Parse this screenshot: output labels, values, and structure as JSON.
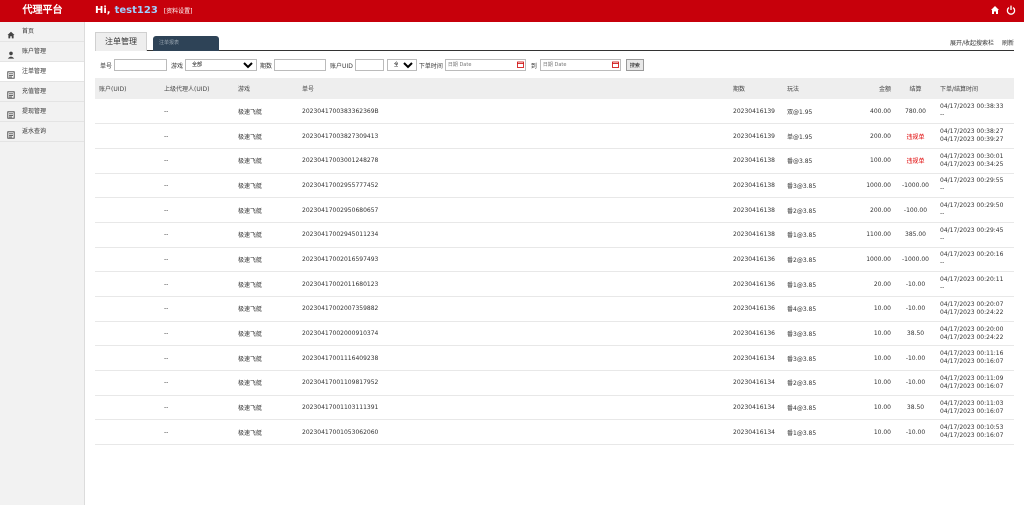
{
  "header": {
    "brand": "代理平台",
    "greeting": "Hi,",
    "username": "test123",
    "settings_link": "[资料设置]"
  },
  "sidebar": {
    "items": [
      {
        "label": "首页",
        "icon": "home-icon"
      },
      {
        "label": "账户管理",
        "icon": "user-icon"
      },
      {
        "label": "注单管理",
        "icon": "list-icon"
      },
      {
        "label": "充值管理",
        "icon": "wallet-icon"
      },
      {
        "label": "提现管理",
        "icon": "cash-icon"
      },
      {
        "label": "返水查询",
        "icon": "rebate-icon"
      }
    ]
  },
  "tabs": {
    "active": "注单管理",
    "secondary": "注单报表",
    "expand_link": "展开/收起搜索栏",
    "refresh_link": "刷新"
  },
  "filter": {
    "order_label": "单号",
    "game_label": "游戏",
    "game_selected": "全部",
    "period_label": "期数",
    "uid_label": "账户UID",
    "uid_scope_selected": "全部",
    "time_label": "下单时间",
    "date_placeholder": "日期 Date",
    "to_label": "到",
    "search_button": "搜索"
  },
  "table": {
    "headers": [
      "账户(UID)",
      "上级代理人(UID)",
      "游戏",
      "单号",
      "期数",
      "玩法",
      "金额",
      "结算",
      "下单/结算时间"
    ],
    "rows": [
      {
        "uid": "",
        "parent": "--",
        "game": "极速飞艇",
        "order": "2023041700383362369B",
        "period": "20230416139",
        "play": "双@1.95",
        "amount": "400.00",
        "settle": "780.00",
        "time1": "04/17/2023 00:38:33",
        "time2": "--"
      },
      {
        "uid": "",
        "parent": "--",
        "game": "极速飞艇",
        "order": "20230417003827309413",
        "period": "20230416139",
        "play": "单@1.95",
        "amount": "200.00",
        "settle": "违规单",
        "time1": "04/17/2023 00:38:27",
        "time2": "04/17/2023 00:39:27"
      },
      {
        "uid": "",
        "parent": "--",
        "game": "极速飞艇",
        "order": "20230417003001248278",
        "period": "20230416138",
        "play": "番@3.85",
        "amount": "100.00",
        "settle": "违规单",
        "time1": "04/17/2023 00:30:01",
        "time2": "04/17/2023 00:34:25"
      },
      {
        "uid": "",
        "parent": "--",
        "game": "极速飞艇",
        "order": "20230417002955777452",
        "period": "20230416138",
        "play": "番3@3.85",
        "amount": "1000.00",
        "settle": "-1000.00",
        "time1": "04/17/2023 00:29:55",
        "time2": "--"
      },
      {
        "uid": "",
        "parent": "--",
        "game": "极速飞艇",
        "order": "20230417002950680657",
        "period": "20230416138",
        "play": "番2@3.85",
        "amount": "200.00",
        "settle": "-100.00",
        "time1": "04/17/2023 00:29:50",
        "time2": "--"
      },
      {
        "uid": "",
        "parent": "--",
        "game": "极速飞艇",
        "order": "20230417002945011234",
        "period": "20230416138",
        "play": "番1@3.85",
        "amount": "1100.00",
        "settle": "385.00",
        "time1": "04/17/2023 00:29:45",
        "time2": "--"
      },
      {
        "uid": "",
        "parent": "--",
        "game": "极速飞艇",
        "order": "20230417002016597493",
        "period": "20230416136",
        "play": "番2@3.85",
        "amount": "1000.00",
        "settle": "-1000.00",
        "time1": "04/17/2023 00:20:16",
        "time2": "--"
      },
      {
        "uid": "",
        "parent": "--",
        "game": "极速飞艇",
        "order": "20230417002011680123",
        "period": "20230416136",
        "play": "番1@3.85",
        "amount": "20.00",
        "settle": "-10.00",
        "time1": "04/17/2023 00:20:11",
        "time2": "--"
      },
      {
        "uid": "",
        "parent": "--",
        "game": "极速飞艇",
        "order": "20230417002007359882",
        "period": "20230416136",
        "play": "番4@3.85",
        "amount": "10.00",
        "settle": "-10.00",
        "time1": "04/17/2023 00:20:07",
        "time2": "04/17/2023 00:24:22"
      },
      {
        "uid": "",
        "parent": "--",
        "game": "极速飞艇",
        "order": "20230417002000910374",
        "period": "20230416136",
        "play": "番3@3.85",
        "amount": "10.00",
        "settle": "38.50",
        "time1": "04/17/2023 00:20:00",
        "time2": "04/17/2023 00:24:22"
      },
      {
        "uid": "",
        "parent": "--",
        "game": "极速飞艇",
        "order": "20230417001116409238",
        "period": "20230416134",
        "play": "番3@3.85",
        "amount": "10.00",
        "settle": "-10.00",
        "time1": "04/17/2023 00:11:16",
        "time2": "04/17/2023 00:16:07"
      },
      {
        "uid": "",
        "parent": "--",
        "game": "极速飞艇",
        "order": "20230417001109817952",
        "period": "20230416134",
        "play": "番2@3.85",
        "amount": "10.00",
        "settle": "-10.00",
        "time1": "04/17/2023 00:11:09",
        "time2": "04/17/2023 00:16:07"
      },
      {
        "uid": "",
        "parent": "--",
        "game": "极速飞艇",
        "order": "20230417001103111391",
        "period": "20230416134",
        "play": "番4@3.85",
        "amount": "10.00",
        "settle": "38.50",
        "time1": "04/17/2023 00:11:03",
        "time2": "04/17/2023 00:16:07"
      },
      {
        "uid": "",
        "parent": "--",
        "game": "极速飞艇",
        "order": "20230417001053062060",
        "period": "20230416134",
        "play": "番1@3.85",
        "amount": "10.00",
        "settle": "-10.00",
        "time1": "04/17/2023 00:10:53",
        "time2": "04/17/2023 00:16:07"
      }
    ]
  },
  "colors": {
    "brand": "#c7000b",
    "accent_user": "#9fd0ff",
    "tab_dark": "#2e4357",
    "violation": "#e00000"
  },
  "top_icons": [
    "home-icon",
    "power-icon"
  ]
}
